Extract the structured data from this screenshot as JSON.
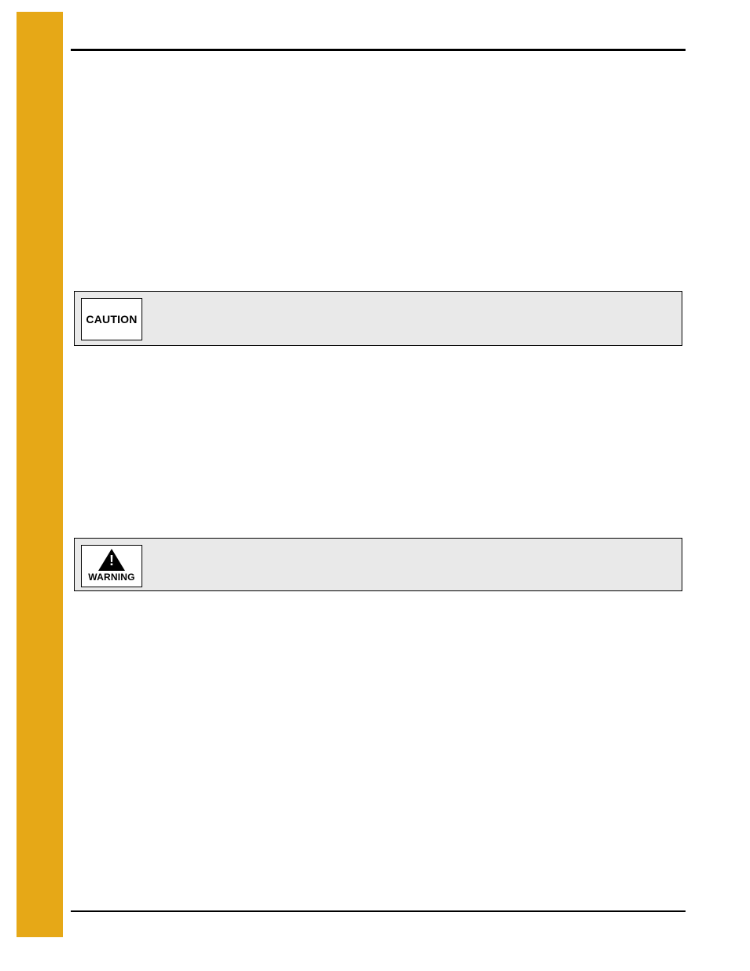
{
  "callouts": {
    "caution_label": "CAUTION",
    "warning_label": "WARNING",
    "warning_symbol": "!"
  }
}
